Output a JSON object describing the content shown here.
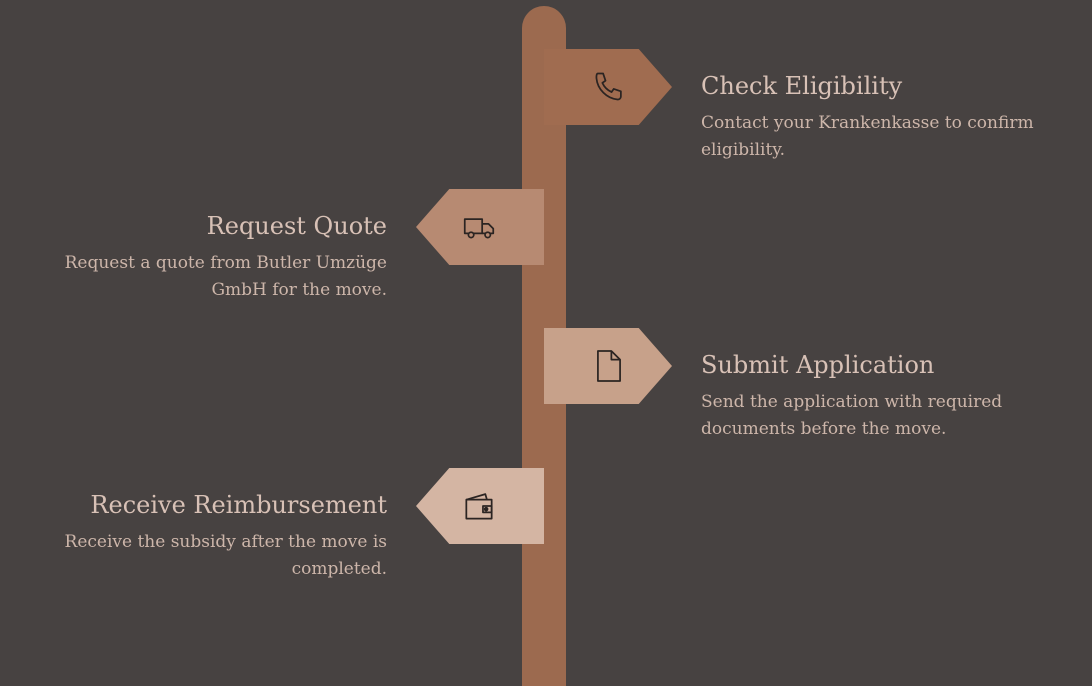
{
  "colors": {
    "background": "#474241",
    "pole": "#9c6a4f"
  },
  "steps": [
    {
      "title": "Check Eligibility",
      "description": "Contact your Krankenkasse to confirm eligibility.",
      "icon": "phone-icon",
      "side": "right",
      "color": "#a06c50"
    },
    {
      "title": "Request Quote",
      "description": "Request a quote from Butler Umzüge GmbH for the move.",
      "icon": "truck-icon",
      "side": "left",
      "color": "#b78a72"
    },
    {
      "title": "Submit Application",
      "description": "Send the application with required documents before the move.",
      "icon": "document-icon",
      "side": "right",
      "color": "#c7a18a"
    },
    {
      "title": "Receive Reimbursement",
      "description": "Receive the subsidy after the move is completed.",
      "icon": "wallet-icon",
      "side": "left",
      "color": "#d4b5a3"
    }
  ]
}
